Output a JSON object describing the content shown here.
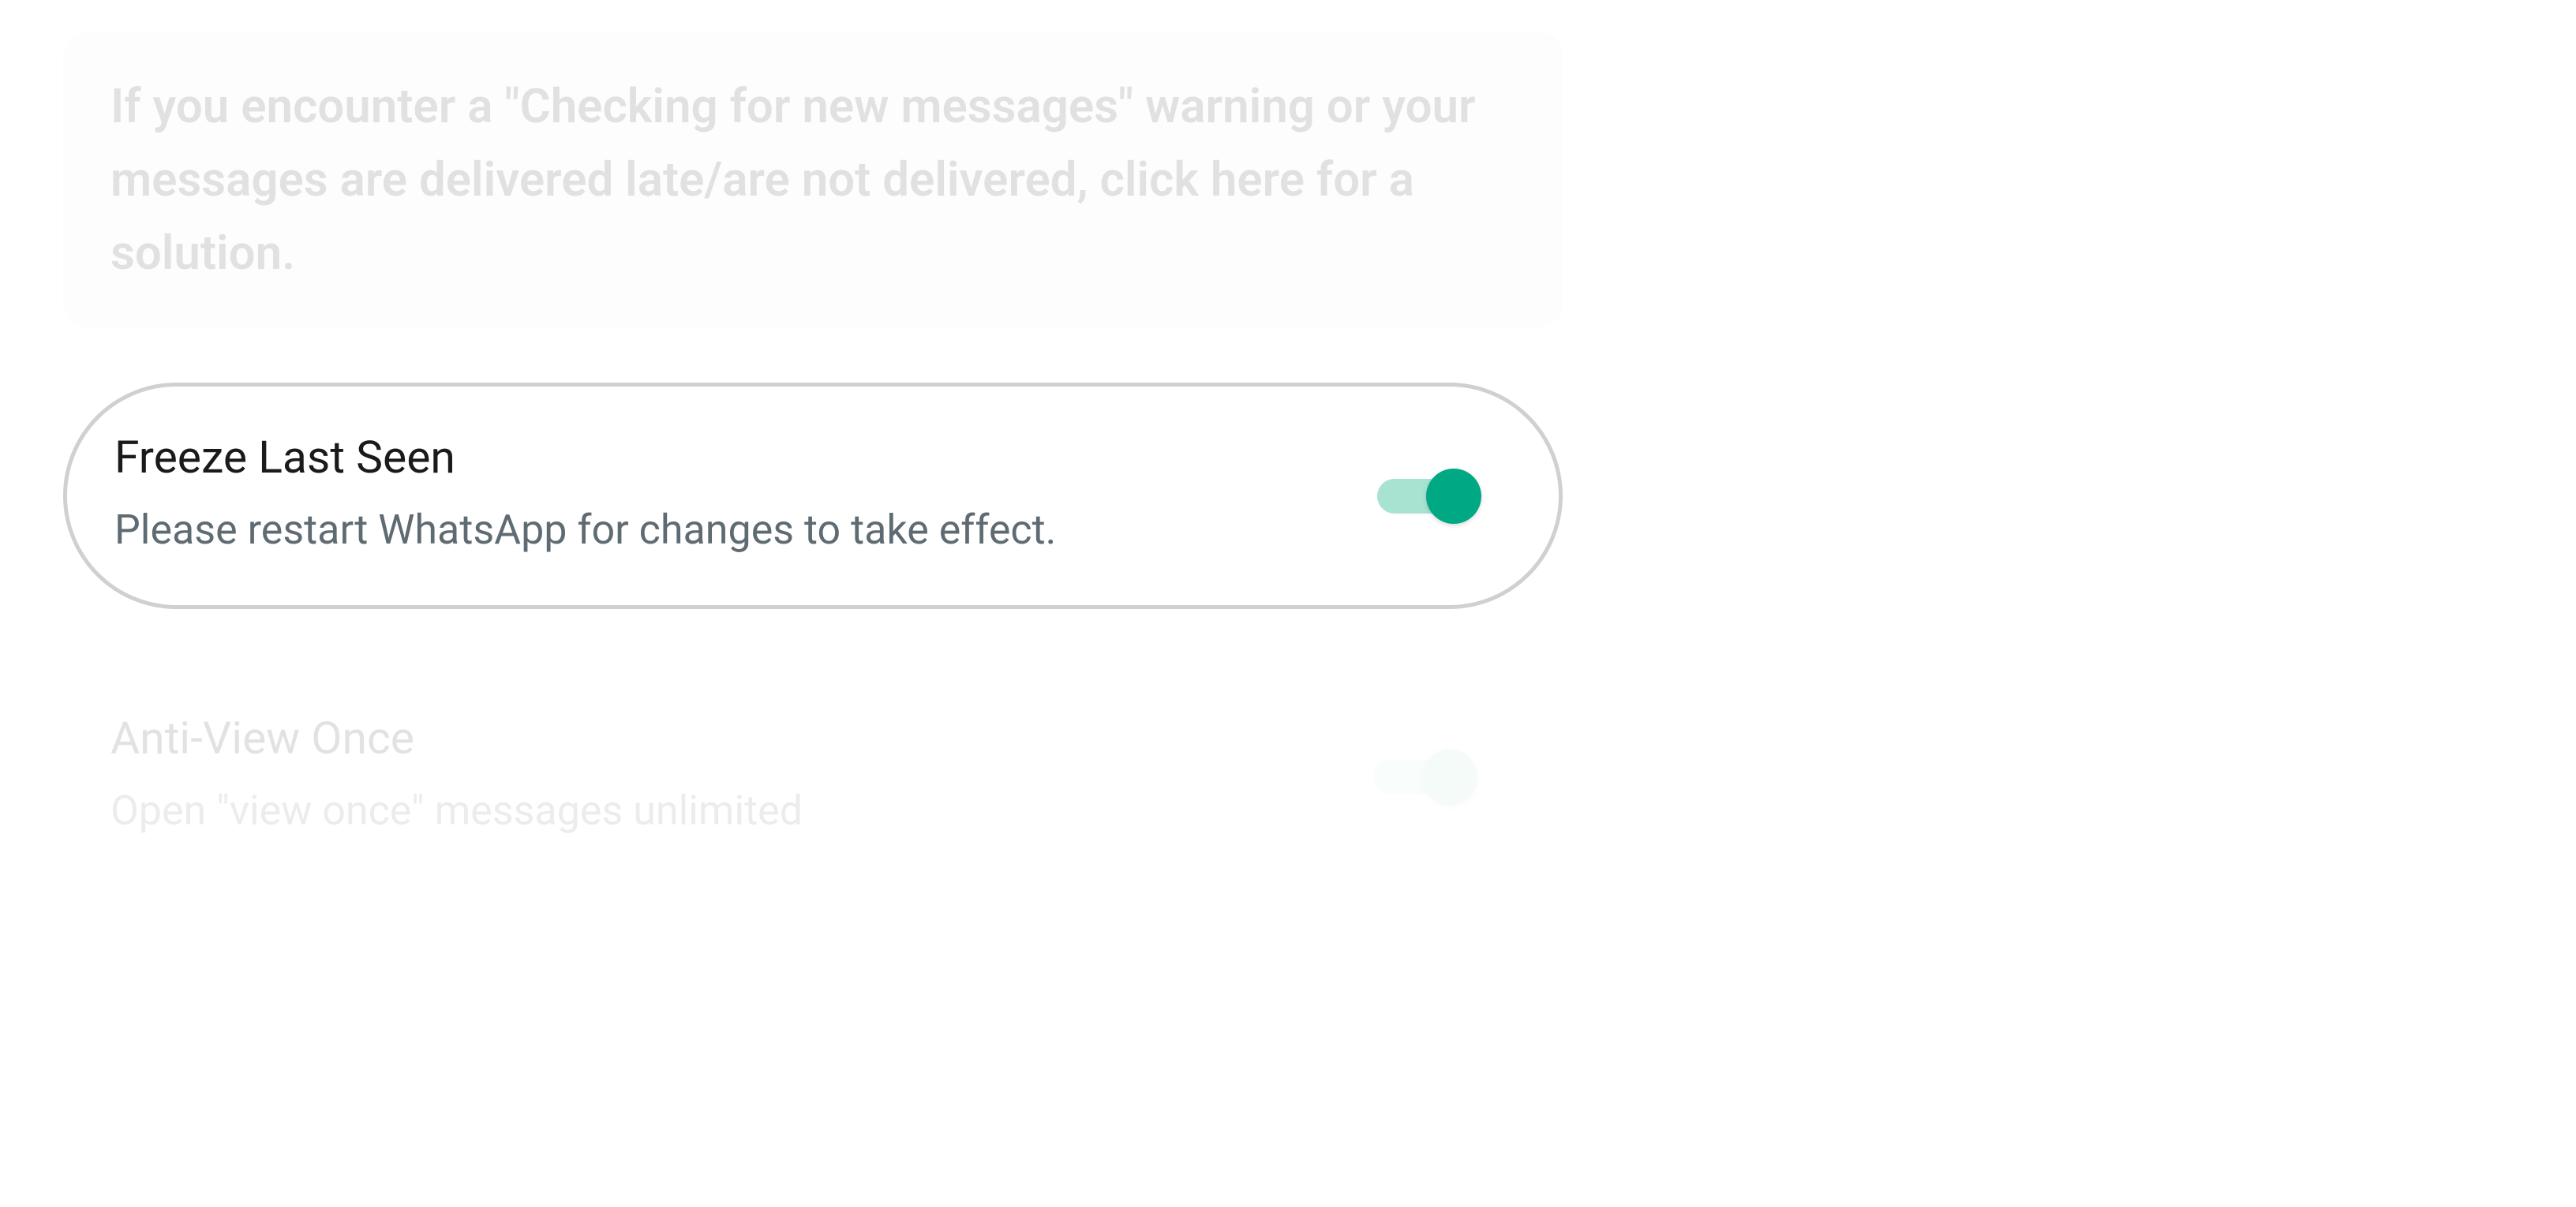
{
  "banner": {
    "text": "If you encounter a \"Checking for new messages\" warning or your messages are delivered late/are not delivered, click here for a solution."
  },
  "settings": {
    "freeze_last_seen": {
      "title": "Freeze Last Seen",
      "subtitle": "Please restart WhatsApp for changes to take effect.",
      "enabled": true
    },
    "anti_view_once": {
      "title": "Anti-View Once",
      "subtitle": "Open \"view once\" messages unlimited",
      "enabled": true
    }
  },
  "colors": {
    "accent": "#00a884",
    "accent_light": "#a8e3d1"
  }
}
